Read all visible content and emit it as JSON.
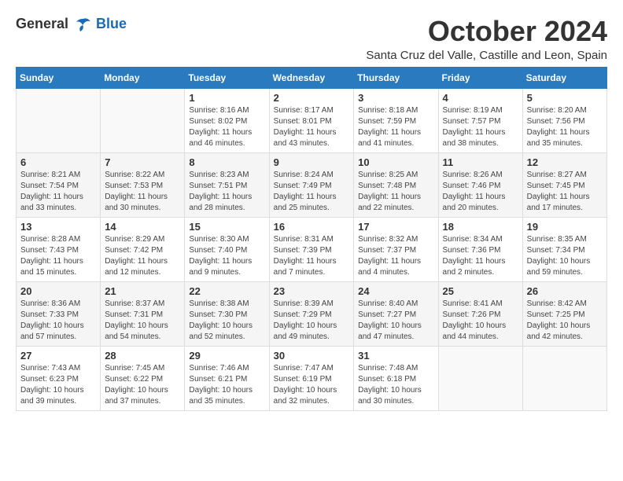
{
  "logo": {
    "general": "General",
    "blue": "Blue"
  },
  "title": "October 2024",
  "location": "Santa Cruz del Valle, Castille and Leon, Spain",
  "weekdays": [
    "Sunday",
    "Monday",
    "Tuesday",
    "Wednesday",
    "Thursday",
    "Friday",
    "Saturday"
  ],
  "weeks": [
    [
      {
        "day": "",
        "sunrise": "",
        "sunset": "",
        "daylight": ""
      },
      {
        "day": "",
        "sunrise": "",
        "sunset": "",
        "daylight": ""
      },
      {
        "day": "1",
        "sunrise": "Sunrise: 8:16 AM",
        "sunset": "Sunset: 8:02 PM",
        "daylight": "Daylight: 11 hours and 46 minutes."
      },
      {
        "day": "2",
        "sunrise": "Sunrise: 8:17 AM",
        "sunset": "Sunset: 8:01 PM",
        "daylight": "Daylight: 11 hours and 43 minutes."
      },
      {
        "day": "3",
        "sunrise": "Sunrise: 8:18 AM",
        "sunset": "Sunset: 7:59 PM",
        "daylight": "Daylight: 11 hours and 41 minutes."
      },
      {
        "day": "4",
        "sunrise": "Sunrise: 8:19 AM",
        "sunset": "Sunset: 7:57 PM",
        "daylight": "Daylight: 11 hours and 38 minutes."
      },
      {
        "day": "5",
        "sunrise": "Sunrise: 8:20 AM",
        "sunset": "Sunset: 7:56 PM",
        "daylight": "Daylight: 11 hours and 35 minutes."
      }
    ],
    [
      {
        "day": "6",
        "sunrise": "Sunrise: 8:21 AM",
        "sunset": "Sunset: 7:54 PM",
        "daylight": "Daylight: 11 hours and 33 minutes."
      },
      {
        "day": "7",
        "sunrise": "Sunrise: 8:22 AM",
        "sunset": "Sunset: 7:53 PM",
        "daylight": "Daylight: 11 hours and 30 minutes."
      },
      {
        "day": "8",
        "sunrise": "Sunrise: 8:23 AM",
        "sunset": "Sunset: 7:51 PM",
        "daylight": "Daylight: 11 hours and 28 minutes."
      },
      {
        "day": "9",
        "sunrise": "Sunrise: 8:24 AM",
        "sunset": "Sunset: 7:49 PM",
        "daylight": "Daylight: 11 hours and 25 minutes."
      },
      {
        "day": "10",
        "sunrise": "Sunrise: 8:25 AM",
        "sunset": "Sunset: 7:48 PM",
        "daylight": "Daylight: 11 hours and 22 minutes."
      },
      {
        "day": "11",
        "sunrise": "Sunrise: 8:26 AM",
        "sunset": "Sunset: 7:46 PM",
        "daylight": "Daylight: 11 hours and 20 minutes."
      },
      {
        "day": "12",
        "sunrise": "Sunrise: 8:27 AM",
        "sunset": "Sunset: 7:45 PM",
        "daylight": "Daylight: 11 hours and 17 minutes."
      }
    ],
    [
      {
        "day": "13",
        "sunrise": "Sunrise: 8:28 AM",
        "sunset": "Sunset: 7:43 PM",
        "daylight": "Daylight: 11 hours and 15 minutes."
      },
      {
        "day": "14",
        "sunrise": "Sunrise: 8:29 AM",
        "sunset": "Sunset: 7:42 PM",
        "daylight": "Daylight: 11 hours and 12 minutes."
      },
      {
        "day": "15",
        "sunrise": "Sunrise: 8:30 AM",
        "sunset": "Sunset: 7:40 PM",
        "daylight": "Daylight: 11 hours and 9 minutes."
      },
      {
        "day": "16",
        "sunrise": "Sunrise: 8:31 AM",
        "sunset": "Sunset: 7:39 PM",
        "daylight": "Daylight: 11 hours and 7 minutes."
      },
      {
        "day": "17",
        "sunrise": "Sunrise: 8:32 AM",
        "sunset": "Sunset: 7:37 PM",
        "daylight": "Daylight: 11 hours and 4 minutes."
      },
      {
        "day": "18",
        "sunrise": "Sunrise: 8:34 AM",
        "sunset": "Sunset: 7:36 PM",
        "daylight": "Daylight: 11 hours and 2 minutes."
      },
      {
        "day": "19",
        "sunrise": "Sunrise: 8:35 AM",
        "sunset": "Sunset: 7:34 PM",
        "daylight": "Daylight: 10 hours and 59 minutes."
      }
    ],
    [
      {
        "day": "20",
        "sunrise": "Sunrise: 8:36 AM",
        "sunset": "Sunset: 7:33 PM",
        "daylight": "Daylight: 10 hours and 57 minutes."
      },
      {
        "day": "21",
        "sunrise": "Sunrise: 8:37 AM",
        "sunset": "Sunset: 7:31 PM",
        "daylight": "Daylight: 10 hours and 54 minutes."
      },
      {
        "day": "22",
        "sunrise": "Sunrise: 8:38 AM",
        "sunset": "Sunset: 7:30 PM",
        "daylight": "Daylight: 10 hours and 52 minutes."
      },
      {
        "day": "23",
        "sunrise": "Sunrise: 8:39 AM",
        "sunset": "Sunset: 7:29 PM",
        "daylight": "Daylight: 10 hours and 49 minutes."
      },
      {
        "day": "24",
        "sunrise": "Sunrise: 8:40 AM",
        "sunset": "Sunset: 7:27 PM",
        "daylight": "Daylight: 10 hours and 47 minutes."
      },
      {
        "day": "25",
        "sunrise": "Sunrise: 8:41 AM",
        "sunset": "Sunset: 7:26 PM",
        "daylight": "Daylight: 10 hours and 44 minutes."
      },
      {
        "day": "26",
        "sunrise": "Sunrise: 8:42 AM",
        "sunset": "Sunset: 7:25 PM",
        "daylight": "Daylight: 10 hours and 42 minutes."
      }
    ],
    [
      {
        "day": "27",
        "sunrise": "Sunrise: 7:43 AM",
        "sunset": "Sunset: 6:23 PM",
        "daylight": "Daylight: 10 hours and 39 minutes."
      },
      {
        "day": "28",
        "sunrise": "Sunrise: 7:45 AM",
        "sunset": "Sunset: 6:22 PM",
        "daylight": "Daylight: 10 hours and 37 minutes."
      },
      {
        "day": "29",
        "sunrise": "Sunrise: 7:46 AM",
        "sunset": "Sunset: 6:21 PM",
        "daylight": "Daylight: 10 hours and 35 minutes."
      },
      {
        "day": "30",
        "sunrise": "Sunrise: 7:47 AM",
        "sunset": "Sunset: 6:19 PM",
        "daylight": "Daylight: 10 hours and 32 minutes."
      },
      {
        "day": "31",
        "sunrise": "Sunrise: 7:48 AM",
        "sunset": "Sunset: 6:18 PM",
        "daylight": "Daylight: 10 hours and 30 minutes."
      },
      {
        "day": "",
        "sunrise": "",
        "sunset": "",
        "daylight": ""
      },
      {
        "day": "",
        "sunrise": "",
        "sunset": "",
        "daylight": ""
      }
    ]
  ]
}
